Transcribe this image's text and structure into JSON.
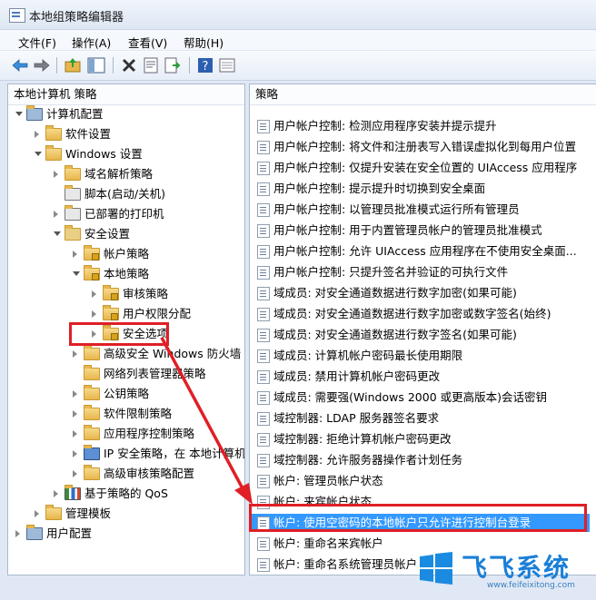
{
  "window": {
    "title": "本地组策略编辑器"
  },
  "menu": [
    "文件(F)",
    "操作(A)",
    "查看(V)",
    "帮助(H)"
  ],
  "left_pane": {
    "root": "本地计算机 策略",
    "items": [
      {
        "label": "计算机配置",
        "icon": "computer-icon"
      },
      {
        "label": "软件设置",
        "icon": "folder-icon"
      },
      {
        "label": "Windows 设置",
        "icon": "folder-icon"
      },
      {
        "label": "域名解析策略",
        "icon": "folder-icon"
      },
      {
        "label": "脚本(启动/关机)",
        "icon": "script-icon"
      },
      {
        "label": "已部署的打印机",
        "icon": "printer-icon"
      },
      {
        "label": "安全设置",
        "icon": "shield-icon"
      },
      {
        "label": "帐户策略",
        "icon": "folder-lock-icon"
      },
      {
        "label": "本地策略",
        "icon": "folder-lock-icon"
      },
      {
        "label": "审核策略",
        "icon": "folder-lock-icon"
      },
      {
        "label": "用户权限分配",
        "icon": "folder-lock-icon"
      },
      {
        "label": "安全选项",
        "icon": "folder-lock-icon"
      },
      {
        "label": "高级安全 Windows 防火墙",
        "icon": "folder-icon"
      },
      {
        "label": "网络列表管理器策略",
        "icon": "folder-icon"
      },
      {
        "label": "公钥策略",
        "icon": "folder-icon"
      },
      {
        "label": "软件限制策略",
        "icon": "folder-icon"
      },
      {
        "label": "应用程序控制策略",
        "icon": "folder-icon"
      },
      {
        "label": "IP 安全策略，在 本地计算机",
        "icon": "ipsec-icon"
      },
      {
        "label": "高级审核策略配置",
        "icon": "folder-icon"
      },
      {
        "label": "基于策略的 QoS",
        "icon": "chart-icon"
      },
      {
        "label": "管理模板",
        "icon": "folder-icon"
      },
      {
        "label": "用户配置",
        "icon": "user-icon"
      }
    ]
  },
  "right_pane": {
    "header": "策略",
    "policies": [
      "用户帐户控制: 检测应用程序安装并提示提升",
      "用户帐户控制: 将文件和注册表写入错误虚拟化到每用户位置",
      "用户帐户控制: 仅提升安装在安全位置的 UIAccess 应用程序",
      "用户帐户控制: 提示提升时切换到安全桌面",
      "用户帐户控制: 以管理员批准模式运行所有管理员",
      "用户帐户控制: 用于内置管理员帐户的管理员批准模式",
      "用户帐户控制: 允许 UIAccess 应用程序在不使用安全桌面...",
      "用户帐户控制: 只提升签名并验证的可执行文件",
      "域成员: 对安全通道数据进行数字加密(如果可能)",
      "域成员: 对安全通道数据进行数字加密或数字签名(始终)",
      "域成员: 对安全通道数据进行数字签名(如果可能)",
      "域成员: 计算机帐户密码最长使用期限",
      "域成员: 禁用计算机帐户密码更改",
      "域成员: 需要强(Windows 2000 或更高版本)会话密钥",
      "域控制器: LDAP 服务器签名要求",
      "域控制器: 拒绝计算机帐户密码更改",
      "域控制器: 允许服务器操作者计划任务",
      "帐户: 管理员帐户状态",
      "帐户: 来宾帐户状态",
      "帐户: 使用空密码的本地帐户只允许进行控制台登录",
      "帐户: 重命名来宾帐户",
      "帐户: 重命名系统管理员帐户"
    ],
    "selected_index": 19
  },
  "watermark": {
    "text": "飞飞系统",
    "url": "www.feifeixitong.com"
  },
  "colors": {
    "selection": "#3399ff",
    "annotation": "#e01f26"
  }
}
